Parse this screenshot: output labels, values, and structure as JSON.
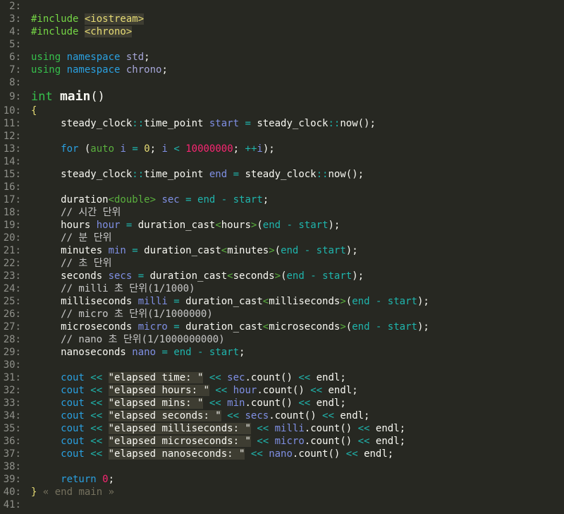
{
  "editor": {
    "lines": [
      {
        "n": "2:",
        "t": []
      },
      {
        "n": "3:",
        "t": [
          [
            "pp",
            "#include "
          ],
          [
            "hdr",
            "<iostream>"
          ]
        ]
      },
      {
        "n": "4:",
        "t": [
          [
            "pp",
            "#include "
          ],
          [
            "hdr",
            "<chrono>"
          ]
        ]
      },
      {
        "n": "5:",
        "t": []
      },
      {
        "n": "6:",
        "t": [
          [
            "kwg",
            "using "
          ],
          [
            "kw",
            "namespace "
          ],
          [
            "ns",
            "std"
          ],
          [
            "id",
            ";"
          ]
        ]
      },
      {
        "n": "7:",
        "t": [
          [
            "kwg",
            "using "
          ],
          [
            "kw",
            "namespace "
          ],
          [
            "ns",
            "chrono"
          ],
          [
            "id",
            ";"
          ]
        ]
      },
      {
        "n": "8:",
        "t": []
      },
      {
        "n": "9:",
        "main": true,
        "t": [
          [
            "kwg",
            "int "
          ],
          [
            "fn",
            "main"
          ],
          [
            "id",
            "()"
          ]
        ]
      },
      {
        "n": "10:",
        "t": [
          [
            "brace",
            "{"
          ]
        ]
      },
      {
        "n": "11:",
        "t": [
          [
            "id",
            "     steady_clock"
          ],
          [
            "op",
            "::"
          ],
          [
            "id",
            "time_point "
          ],
          [
            "var",
            "start"
          ],
          [
            "op",
            " = "
          ],
          [
            "id",
            "steady_clock"
          ],
          [
            "op",
            "::"
          ],
          [
            "id",
            "now();"
          ]
        ]
      },
      {
        "n": "12:",
        "t": []
      },
      {
        "n": "13:",
        "t": [
          [
            "kw",
            "     for "
          ],
          [
            "id",
            "("
          ],
          [
            "typ",
            "auto "
          ],
          [
            "var",
            "i"
          ],
          [
            "op",
            " = "
          ],
          [
            "numy",
            "0"
          ],
          [
            "id",
            "; "
          ],
          [
            "var",
            "i"
          ],
          [
            "op",
            " < "
          ],
          [
            "num",
            "10000000"
          ],
          [
            "id",
            "; "
          ],
          [
            "op",
            "++"
          ],
          [
            "var",
            "i"
          ],
          [
            "id",
            ");"
          ]
        ]
      },
      {
        "n": "14:",
        "t": []
      },
      {
        "n": "15:",
        "t": [
          [
            "id",
            "     steady_clock"
          ],
          [
            "op",
            "::"
          ],
          [
            "id",
            "time_point "
          ],
          [
            "var",
            "end"
          ],
          [
            "op",
            " = "
          ],
          [
            "id",
            "steady_clock"
          ],
          [
            "op",
            "::"
          ],
          [
            "id",
            "now();"
          ]
        ]
      },
      {
        "n": "16:",
        "t": []
      },
      {
        "n": "17:",
        "t": [
          [
            "id",
            "     duration"
          ],
          [
            "typ",
            "<double>"
          ],
          [
            "var",
            " sec"
          ],
          [
            "op",
            " = "
          ],
          [
            "op",
            "end"
          ],
          [
            "op",
            " - "
          ],
          [
            "op",
            "start"
          ],
          [
            "id",
            ";"
          ]
        ]
      },
      {
        "n": "18:",
        "t": [
          [
            "cm",
            "     // 시간 단위"
          ]
        ]
      },
      {
        "n": "19:",
        "t": [
          [
            "id",
            "     hours "
          ],
          [
            "var",
            "hour"
          ],
          [
            "op",
            " = "
          ],
          [
            "id",
            "duration_cast"
          ],
          [
            "typ",
            "<"
          ],
          [
            "id",
            "hours"
          ],
          [
            "typ",
            ">"
          ],
          [
            "id",
            "("
          ],
          [
            "op",
            "end - start"
          ],
          [
            "id",
            ");"
          ]
        ]
      },
      {
        "n": "20:",
        "t": [
          [
            "cm",
            "     // 분 단위"
          ]
        ]
      },
      {
        "n": "21:",
        "t": [
          [
            "id",
            "     minutes "
          ],
          [
            "var",
            "min"
          ],
          [
            "op",
            " = "
          ],
          [
            "id",
            "duration_cast"
          ],
          [
            "typ",
            "<"
          ],
          [
            "id",
            "minutes"
          ],
          [
            "typ",
            ">"
          ],
          [
            "id",
            "("
          ],
          [
            "op",
            "end - start"
          ],
          [
            "id",
            ");"
          ]
        ]
      },
      {
        "n": "22:",
        "t": [
          [
            "cm",
            "     // 초 단위"
          ]
        ]
      },
      {
        "n": "23:",
        "t": [
          [
            "id",
            "     seconds "
          ],
          [
            "var",
            "secs"
          ],
          [
            "op",
            " = "
          ],
          [
            "id",
            "duration_cast"
          ],
          [
            "typ",
            "<"
          ],
          [
            "id",
            "seconds"
          ],
          [
            "typ",
            ">"
          ],
          [
            "id",
            "("
          ],
          [
            "op",
            "end - start"
          ],
          [
            "id",
            ");"
          ]
        ]
      },
      {
        "n": "24:",
        "t": [
          [
            "cm",
            "     // milli 초 단위(1/1000)"
          ]
        ]
      },
      {
        "n": "25:",
        "t": [
          [
            "id",
            "     milliseconds "
          ],
          [
            "var",
            "milli"
          ],
          [
            "op",
            " = "
          ],
          [
            "id",
            "duration_cast"
          ],
          [
            "typ",
            "<"
          ],
          [
            "id",
            "milliseconds"
          ],
          [
            "typ",
            ">"
          ],
          [
            "id",
            "("
          ],
          [
            "op",
            "end - start"
          ],
          [
            "id",
            ");"
          ]
        ]
      },
      {
        "n": "26:",
        "t": [
          [
            "cm",
            "     // micro 초 단위(1/1000000)"
          ]
        ]
      },
      {
        "n": "27:",
        "t": [
          [
            "id",
            "     microseconds "
          ],
          [
            "var",
            "micro"
          ],
          [
            "op",
            " = "
          ],
          [
            "id",
            "duration_cast"
          ],
          [
            "typ",
            "<"
          ],
          [
            "id",
            "microseconds"
          ],
          [
            "typ",
            ">"
          ],
          [
            "id",
            "("
          ],
          [
            "op",
            "end - start"
          ],
          [
            "id",
            ");"
          ]
        ]
      },
      {
        "n": "28:",
        "t": [
          [
            "cm",
            "     // nano 초 단위(1/1000000000)"
          ]
        ]
      },
      {
        "n": "29:",
        "t": [
          [
            "id",
            "     nanoseconds "
          ],
          [
            "var",
            "nano"
          ],
          [
            "op",
            " = "
          ],
          [
            "op",
            "end - start"
          ],
          [
            "id",
            ";"
          ]
        ]
      },
      {
        "n": "30:",
        "t": []
      },
      {
        "n": "31:",
        "t": [
          [
            "kw",
            "     cout "
          ],
          [
            "op",
            "<< "
          ],
          [
            "str",
            "\"elapsed time: \""
          ],
          [
            "op",
            " << "
          ],
          [
            "var",
            "sec"
          ],
          [
            "id",
            ".count() "
          ],
          [
            "op",
            "<< "
          ],
          [
            "id",
            "endl;"
          ]
        ]
      },
      {
        "n": "32:",
        "t": [
          [
            "kw",
            "     cout "
          ],
          [
            "op",
            "<< "
          ],
          [
            "str",
            "\"elapsed hours: \""
          ],
          [
            "op",
            " << "
          ],
          [
            "var",
            "hour"
          ],
          [
            "id",
            ".count() "
          ],
          [
            "op",
            "<< "
          ],
          [
            "id",
            "endl;"
          ]
        ]
      },
      {
        "n": "33:",
        "t": [
          [
            "kw",
            "     cout "
          ],
          [
            "op",
            "<< "
          ],
          [
            "str",
            "\"elapsed mins: \""
          ],
          [
            "op",
            " << "
          ],
          [
            "var",
            "min"
          ],
          [
            "id",
            ".count() "
          ],
          [
            "op",
            "<< "
          ],
          [
            "id",
            "endl;"
          ]
        ]
      },
      {
        "n": "34:",
        "t": [
          [
            "kw",
            "     cout "
          ],
          [
            "op",
            "<< "
          ],
          [
            "str",
            "\"elapsed seconds: \""
          ],
          [
            "op",
            " << "
          ],
          [
            "var",
            "secs"
          ],
          [
            "id",
            ".count() "
          ],
          [
            "op",
            "<< "
          ],
          [
            "id",
            "endl;"
          ]
        ]
      },
      {
        "n": "35:",
        "t": [
          [
            "kw",
            "     cout "
          ],
          [
            "op",
            "<< "
          ],
          [
            "str",
            "\"elapsed milliseconds: \""
          ],
          [
            "op",
            " << "
          ],
          [
            "var",
            "milli"
          ],
          [
            "id",
            ".count() "
          ],
          [
            "op",
            "<< "
          ],
          [
            "id",
            "endl;"
          ]
        ]
      },
      {
        "n": "36:",
        "t": [
          [
            "kw",
            "     cout "
          ],
          [
            "op",
            "<< "
          ],
          [
            "str",
            "\"elapsed microseconds: \""
          ],
          [
            "op",
            " << "
          ],
          [
            "var",
            "micro"
          ],
          [
            "id",
            ".count() "
          ],
          [
            "op",
            "<< "
          ],
          [
            "id",
            "endl;"
          ]
        ]
      },
      {
        "n": "37:",
        "t": [
          [
            "kw",
            "     cout "
          ],
          [
            "op",
            "<< "
          ],
          [
            "str",
            "\"elapsed nanoseconds: \""
          ],
          [
            "op",
            " << "
          ],
          [
            "var",
            "nano"
          ],
          [
            "id",
            ".count() "
          ],
          [
            "op",
            "<< "
          ],
          [
            "id",
            "endl;"
          ]
        ]
      },
      {
        "n": "38:",
        "t": []
      },
      {
        "n": "39:",
        "t": [
          [
            "kw",
            "     return "
          ],
          [
            "num",
            "0"
          ],
          [
            "id",
            ";"
          ]
        ]
      },
      {
        "n": "40:",
        "t": [
          [
            "brace",
            "}"
          ],
          [
            "fold",
            " « end main »"
          ]
        ]
      },
      {
        "n": "41:",
        "t": []
      }
    ]
  },
  "colors": {
    "background": "#272822",
    "line_number": "#8f908a",
    "keyword": "#2aa0e0",
    "preprocessor": "#75d645",
    "string_bg": "#3e3d32"
  }
}
